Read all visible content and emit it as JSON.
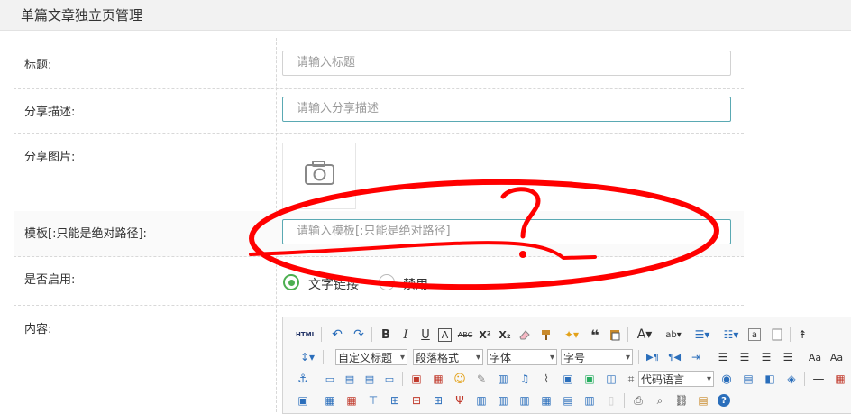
{
  "page": {
    "title": "单篇文章独立页管理"
  },
  "form": {
    "title_label": "标题:",
    "title_placeholder": "请输入标题",
    "desc_label": "分享描述:",
    "desc_placeholder": "请输入分享描述",
    "image_label": "分享图片:",
    "template_label": "模板[:只能是绝对路径]:",
    "template_placeholder": "请输入模板[:只能是绝对路径]",
    "enable_label": "是否启用:",
    "enable_options": [
      "文字链接",
      "禁用"
    ],
    "enable_selected": "文字链接",
    "content_label": "内容:"
  },
  "editor": {
    "html_label": "HTML",
    "custom_heading": "自定义标题",
    "paragraph": "段落格式",
    "font": "字体",
    "font_size": "字号",
    "code_lang": "代码语言"
  },
  "annotation": {
    "mark": "?",
    "color": "#ff0000"
  }
}
